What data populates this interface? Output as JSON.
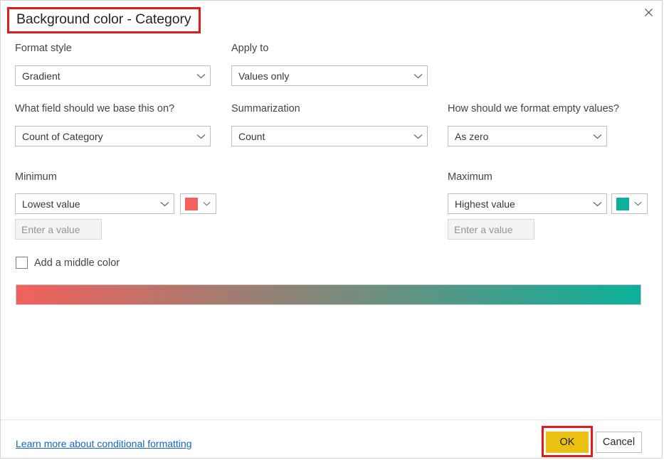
{
  "dialog": {
    "title": "Background color - Category",
    "close_icon": "close-icon"
  },
  "fields": {
    "format_style": {
      "label": "Format style",
      "value": "Gradient"
    },
    "apply_to": {
      "label": "Apply to",
      "value": "Values only"
    },
    "base_field": {
      "label": "What field should we base this on?",
      "value": "Count of Category"
    },
    "summarization": {
      "label": "Summarization",
      "value": "Count"
    },
    "empty_values": {
      "label": "How should we format empty values?",
      "value": "As zero"
    },
    "minimum": {
      "label": "Minimum",
      "value": "Lowest value",
      "input_placeholder": "Enter a value",
      "input_value": "",
      "color": "#f2615c"
    },
    "maximum": {
      "label": "Maximum",
      "value": "Highest value",
      "input_placeholder": "Enter a value",
      "input_value": "",
      "color": "#0fb09b"
    },
    "middle_color": {
      "label": "Add a middle color",
      "checked": false
    }
  },
  "gradient_preview": {
    "from_color": "#f2615c",
    "to_color": "#0cb09a"
  },
  "footer": {
    "learn_more_link": "Learn more about conditional formatting",
    "ok_label": "OK",
    "cancel_label": "Cancel",
    "highlight_color": "#e01b1b"
  }
}
